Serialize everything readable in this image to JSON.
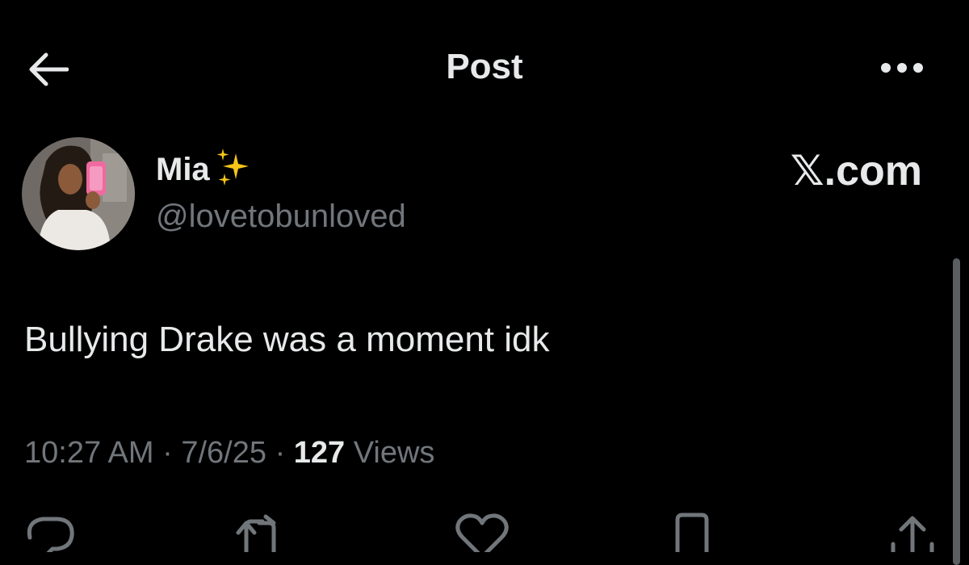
{
  "header": {
    "title": "Post",
    "back_icon": "arrow-left-icon",
    "more_icon": "more-horizontal-icon"
  },
  "post": {
    "author": {
      "display_name": "Mia",
      "emoji": "sparkles-icon",
      "handle": "@lovetobunloved"
    },
    "watermark": "𝕏.com",
    "text": "Bullying Drake was a moment idk",
    "time": "10:27 AM",
    "date": "7/6/25",
    "separator": "·",
    "views_count": "127",
    "views_label": "Views"
  },
  "actions": [
    "reply-icon",
    "repost-icon",
    "like-icon",
    "bookmark-icon",
    "share-icon"
  ],
  "colors": {
    "background": "#000000",
    "text_primary": "#e7e9ea",
    "text_secondary": "#71767b",
    "sparkle": "#f5c518"
  }
}
